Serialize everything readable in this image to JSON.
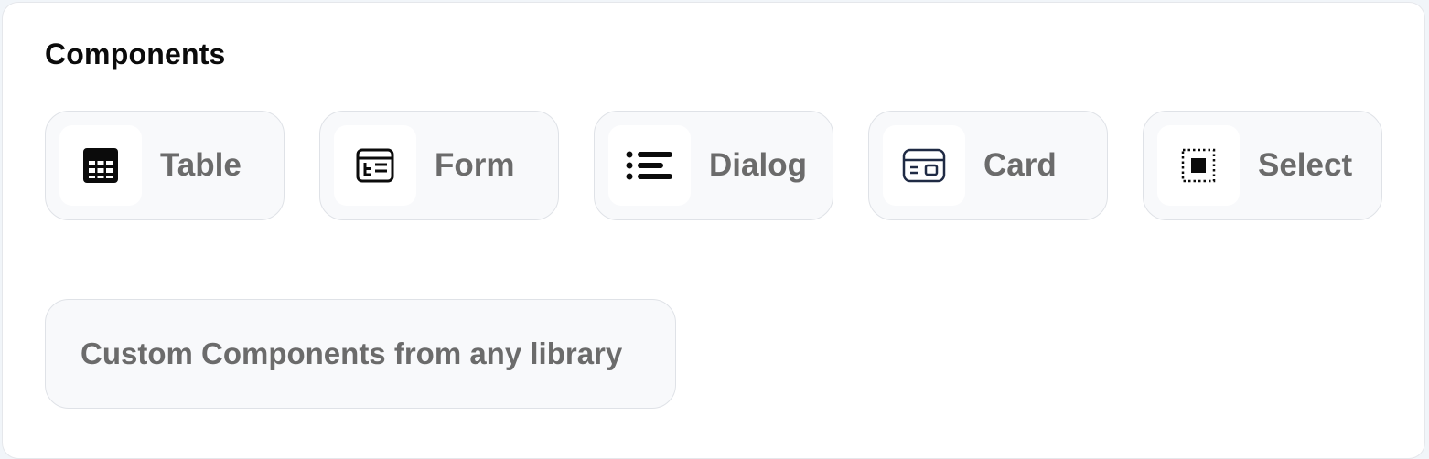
{
  "section": {
    "title": "Components"
  },
  "components": [
    {
      "label": "Table",
      "icon": "table-icon"
    },
    {
      "label": "Form",
      "icon": "form-icon"
    },
    {
      "label": "Dialog",
      "icon": "list-icon"
    },
    {
      "label": "Card",
      "icon": "card-icon"
    },
    {
      "label": "Select",
      "icon": "select-icon"
    }
  ],
  "custom": {
    "label": "Custom Components from any library"
  },
  "colors": {
    "text_primary": "#0b0b0b",
    "text_muted": "#6b6b6b",
    "chip_bg": "#f8f9fb",
    "chip_border": "#dfe2e7"
  }
}
